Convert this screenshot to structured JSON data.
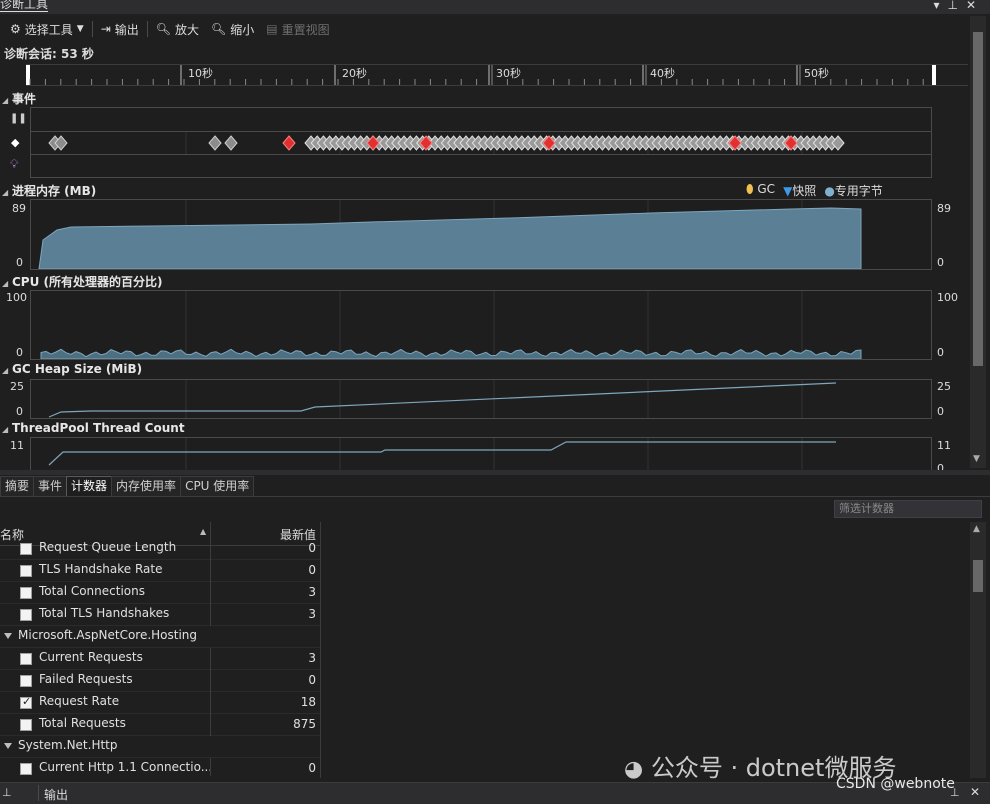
{
  "panel": {
    "title": "诊断工具"
  },
  "toolbar": {
    "select_tool": "选择工具",
    "output": "输出",
    "zoom_in": "放大",
    "zoom_out": "缩小",
    "reset_view": "重置视图"
  },
  "session": {
    "label": "诊断会话: 53 秒"
  },
  "ruler": {
    "ticks": [
      "10秒",
      "20秒",
      "30秒",
      "40秒",
      "50秒"
    ]
  },
  "events": {
    "title": "事件"
  },
  "memory": {
    "title": "进程内存 (MB)",
    "max": "89",
    "min": "0",
    "legend": {
      "gc": "GC",
      "snapshot": "快照",
      "private": "专用字节"
    },
    "color": "#5b7f94"
  },
  "cpu": {
    "title": "CPU (所有处理器的百分比)",
    "max": "100",
    "min": "0"
  },
  "gcheap": {
    "title": "GC Heap Size (MiB)",
    "max": "25",
    "min": "0"
  },
  "threadpool": {
    "title": "ThreadPool Thread Count",
    "max": "11",
    "min": "0"
  },
  "tabs": [
    {
      "label": "摘要"
    },
    {
      "label": "事件"
    },
    {
      "label": "计数器"
    },
    {
      "label": "内存使用率"
    },
    {
      "label": "CPU 使用率"
    }
  ],
  "filter": {
    "placeholder": "筛选计数器"
  },
  "grid": {
    "col_name": "名称",
    "col_value": "最新值",
    "rows": [
      {
        "type": "item",
        "name": "Request Queue Length",
        "value": "0",
        "checked": false
      },
      {
        "type": "item",
        "name": "TLS Handshake Rate",
        "value": "0",
        "checked": false
      },
      {
        "type": "item",
        "name": "Total Connections",
        "value": "3",
        "checked": false
      },
      {
        "type": "item",
        "name": "Total TLS Handshakes",
        "value": "3",
        "checked": false
      },
      {
        "type": "group",
        "name": "Microsoft.AspNetCore.Hosting"
      },
      {
        "type": "item",
        "name": "Current Requests",
        "value": "3",
        "checked": false
      },
      {
        "type": "item",
        "name": "Failed Requests",
        "value": "0",
        "checked": false
      },
      {
        "type": "item",
        "name": "Request Rate",
        "value": "18",
        "checked": true
      },
      {
        "type": "item",
        "name": "Total Requests",
        "value": "875",
        "checked": false
      },
      {
        "type": "group",
        "name": "System.Net.Http"
      },
      {
        "type": "item",
        "name": "Current Http 1.1 Connectio...",
        "value": "0",
        "checked": false
      }
    ]
  },
  "statusbar": {
    "output_tab": "输出"
  },
  "watermark": {
    "line1": "公众号 · dotnet微服务",
    "line2": "CSDN @webnote"
  }
}
